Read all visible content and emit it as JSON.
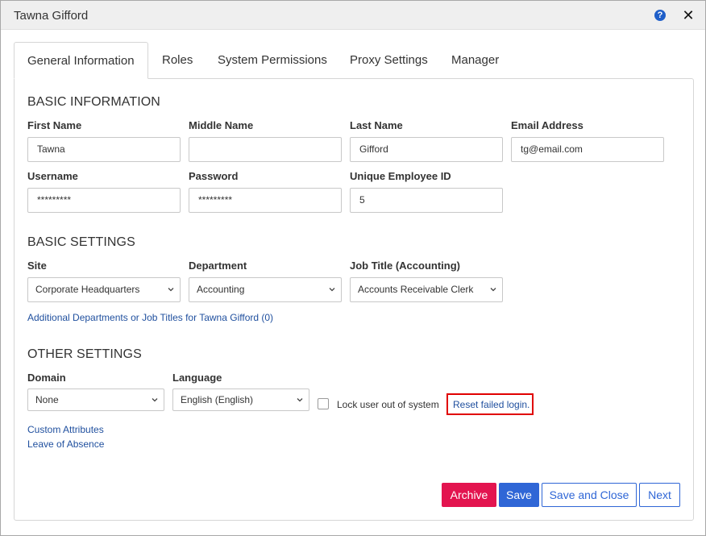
{
  "window": {
    "title": "Tawna Gifford"
  },
  "tabs": [
    {
      "label": "General Information",
      "active": true
    },
    {
      "label": "Roles"
    },
    {
      "label": "System Permissions"
    },
    {
      "label": "Proxy Settings"
    },
    {
      "label": "Manager"
    }
  ],
  "basic_information": {
    "title": "BASIC INFORMATION",
    "first_name": {
      "label": "First Name",
      "value": "Tawna"
    },
    "middle_name": {
      "label": "Middle Name",
      "value": ""
    },
    "last_name": {
      "label": "Last Name",
      "value": "Gifford"
    },
    "email": {
      "label": "Email Address",
      "value": "tg@email.com"
    },
    "username": {
      "label": "Username",
      "value": "*********"
    },
    "password": {
      "label": "Password",
      "value": "*********"
    },
    "employee_id": {
      "label": "Unique Employee ID",
      "value": "5"
    }
  },
  "basic_settings": {
    "title": "BASIC SETTINGS",
    "site": {
      "label": "Site",
      "value": "Corporate Headquarters"
    },
    "department": {
      "label": "Department",
      "value": "Accounting"
    },
    "job_title": {
      "label": "Job Title (Accounting)",
      "value": "Accounts Receivable Clerk"
    },
    "additional_link": "Additional Departments or Job Titles for Tawna Gifford (0)"
  },
  "other_settings": {
    "title": "OTHER SETTINGS",
    "domain": {
      "label": "Domain",
      "value": "None"
    },
    "language": {
      "label": "Language",
      "value": "English (English)"
    },
    "lock_label": "Lock user out of system",
    "reset_link": "Reset failed login.",
    "custom_attributes": "Custom Attributes",
    "leave_of_absence": "Leave of Absence"
  },
  "buttons": {
    "archive": "Archive",
    "save": "Save",
    "save_close": "Save and Close",
    "next": "Next"
  },
  "icons": {
    "help": "?",
    "close": "✕"
  },
  "colors": {
    "archive": "#e3144f",
    "primary": "#2f66d6",
    "link": "#1f4f9e",
    "highlight": "#e00000"
  }
}
